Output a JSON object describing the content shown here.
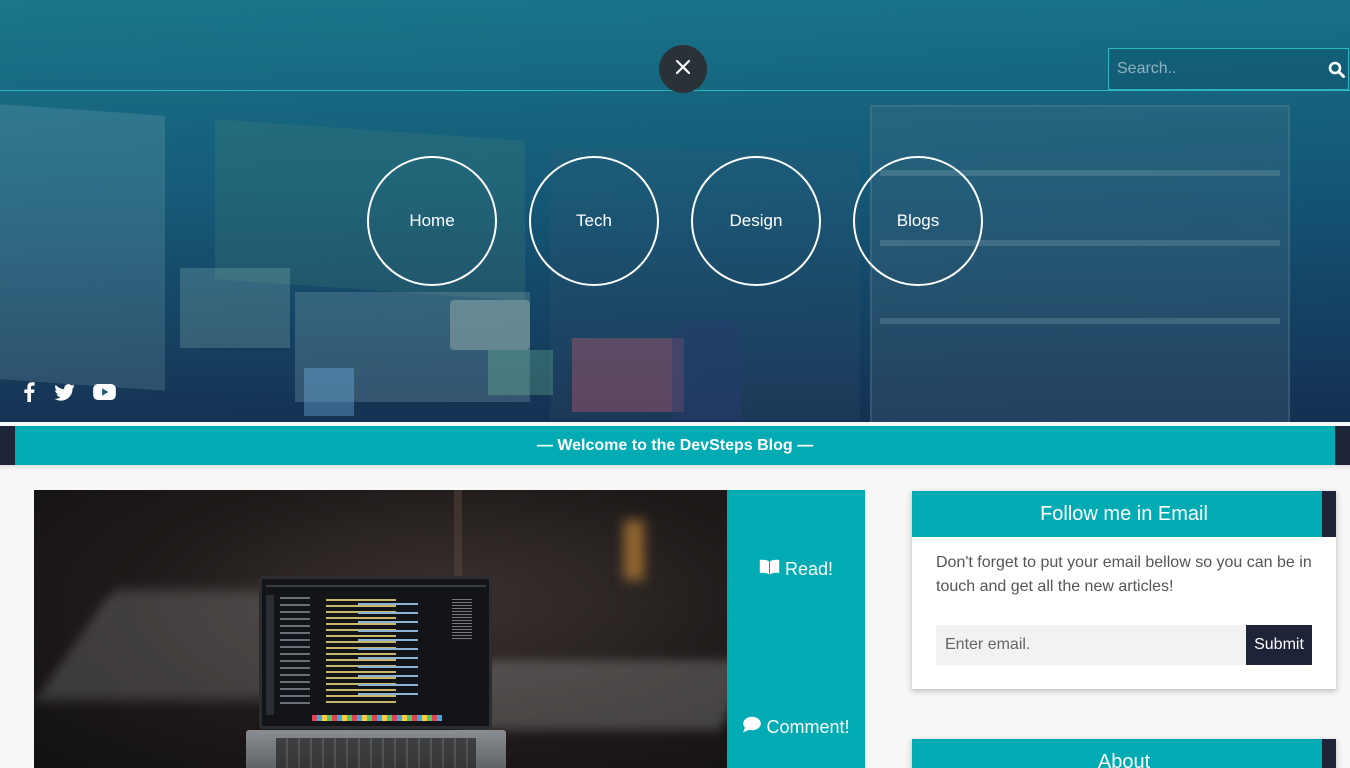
{
  "search": {
    "placeholder": "Search.."
  },
  "nav": {
    "items": [
      {
        "label": "Home"
      },
      {
        "label": "Tech"
      },
      {
        "label": "Design"
      },
      {
        "label": "Blogs"
      }
    ]
  },
  "social": [
    "facebook-icon",
    "twitter-icon",
    "youtube-icon"
  ],
  "welcome": {
    "text": "— Welcome to the DevSteps Blog —"
  },
  "post": {
    "read_label": "Read!",
    "comment_label": "Comment!"
  },
  "email_widget": {
    "title": "Follow me in Email",
    "description": "Don't forget to put your email bellow so you can be in touch and get all the new articles!",
    "email_placeholder": "Enter email.",
    "submit_label": "Submit"
  },
  "about_widget": {
    "title": "About"
  },
  "colors": {
    "accent": "#00abb4",
    "dark": "#1d2437",
    "close_button": "#2a3238"
  }
}
